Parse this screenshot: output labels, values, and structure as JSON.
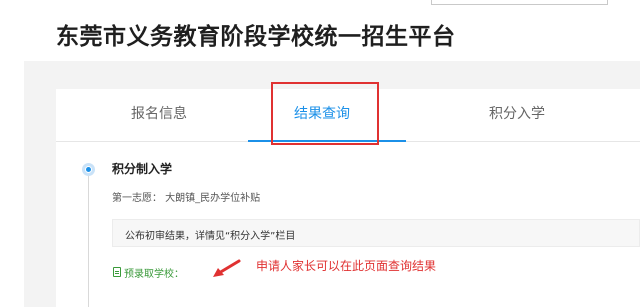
{
  "header": {
    "title": "东莞市义务教育阶段学校统一招生平台"
  },
  "tabs": [
    {
      "label": "报名信息"
    },
    {
      "label": "结果查询"
    },
    {
      "label": "积分入学"
    }
  ],
  "active_tab": "结果查询",
  "timeline": {
    "section_title": "积分制入学",
    "choice_text": "第一志愿： 大朗镇_民办学位补贴",
    "notice_text": "公布初审结果，详情见“积分入学”栏目",
    "admit_label": "预录取学校："
  },
  "annotation": {
    "text": "申请人家长可以在此页面查询结果"
  },
  "colors": {
    "accent": "#1b90e8",
    "highlight": "#e03131",
    "success": "#3a9a3a"
  }
}
